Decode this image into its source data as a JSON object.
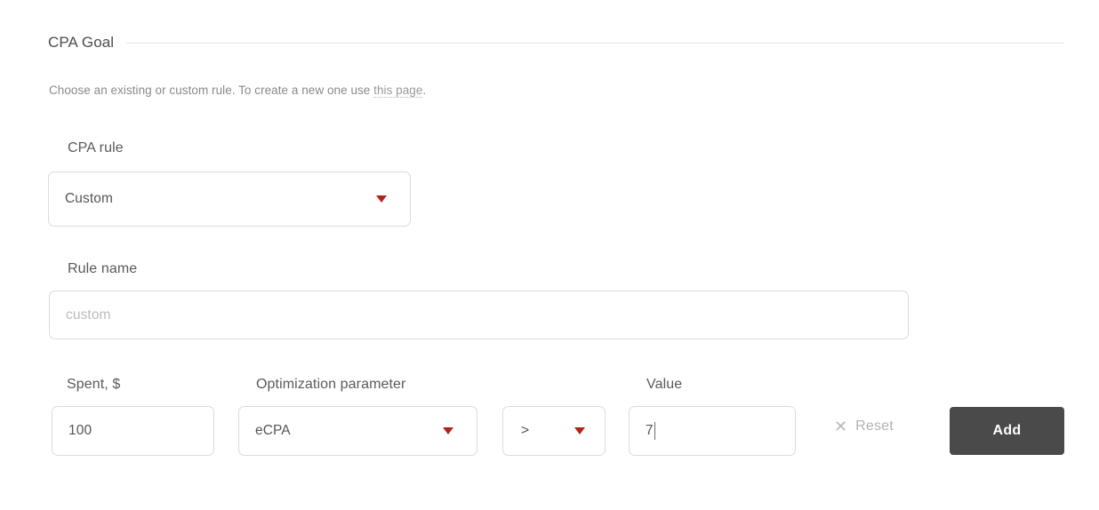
{
  "section": {
    "title": "CPA Goal",
    "description_before": "Choose an existing or custom rule. To create a new one use ",
    "description_link": "this page",
    "description_after": "."
  },
  "cpa_rule": {
    "label": "CPA rule",
    "value": "Custom",
    "caret_icon": "chevron-down-icon"
  },
  "rule_name": {
    "label": "Rule name",
    "value": "",
    "placeholder": "custom"
  },
  "spent": {
    "label": "Spent, $",
    "value": "100"
  },
  "optimization_parameter": {
    "label": "Optimization parameter",
    "value": "eCPA",
    "caret_icon": "chevron-down-icon"
  },
  "operator": {
    "value": ">",
    "caret_icon": "chevron-down-icon"
  },
  "value_field": {
    "label": "Value",
    "value": "7",
    "focused": true
  },
  "reset": {
    "label": "Reset",
    "icon": "close-x-icon"
  },
  "add": {
    "label": "Add"
  },
  "colors": {
    "caret_red": "#b02418",
    "add_button_bg": "#4a4a4a",
    "label_text": "#5a5a5a",
    "muted_text": "#8a8a8a",
    "disabled_text": "#b3b3b3",
    "border": "#dcdcdc"
  }
}
